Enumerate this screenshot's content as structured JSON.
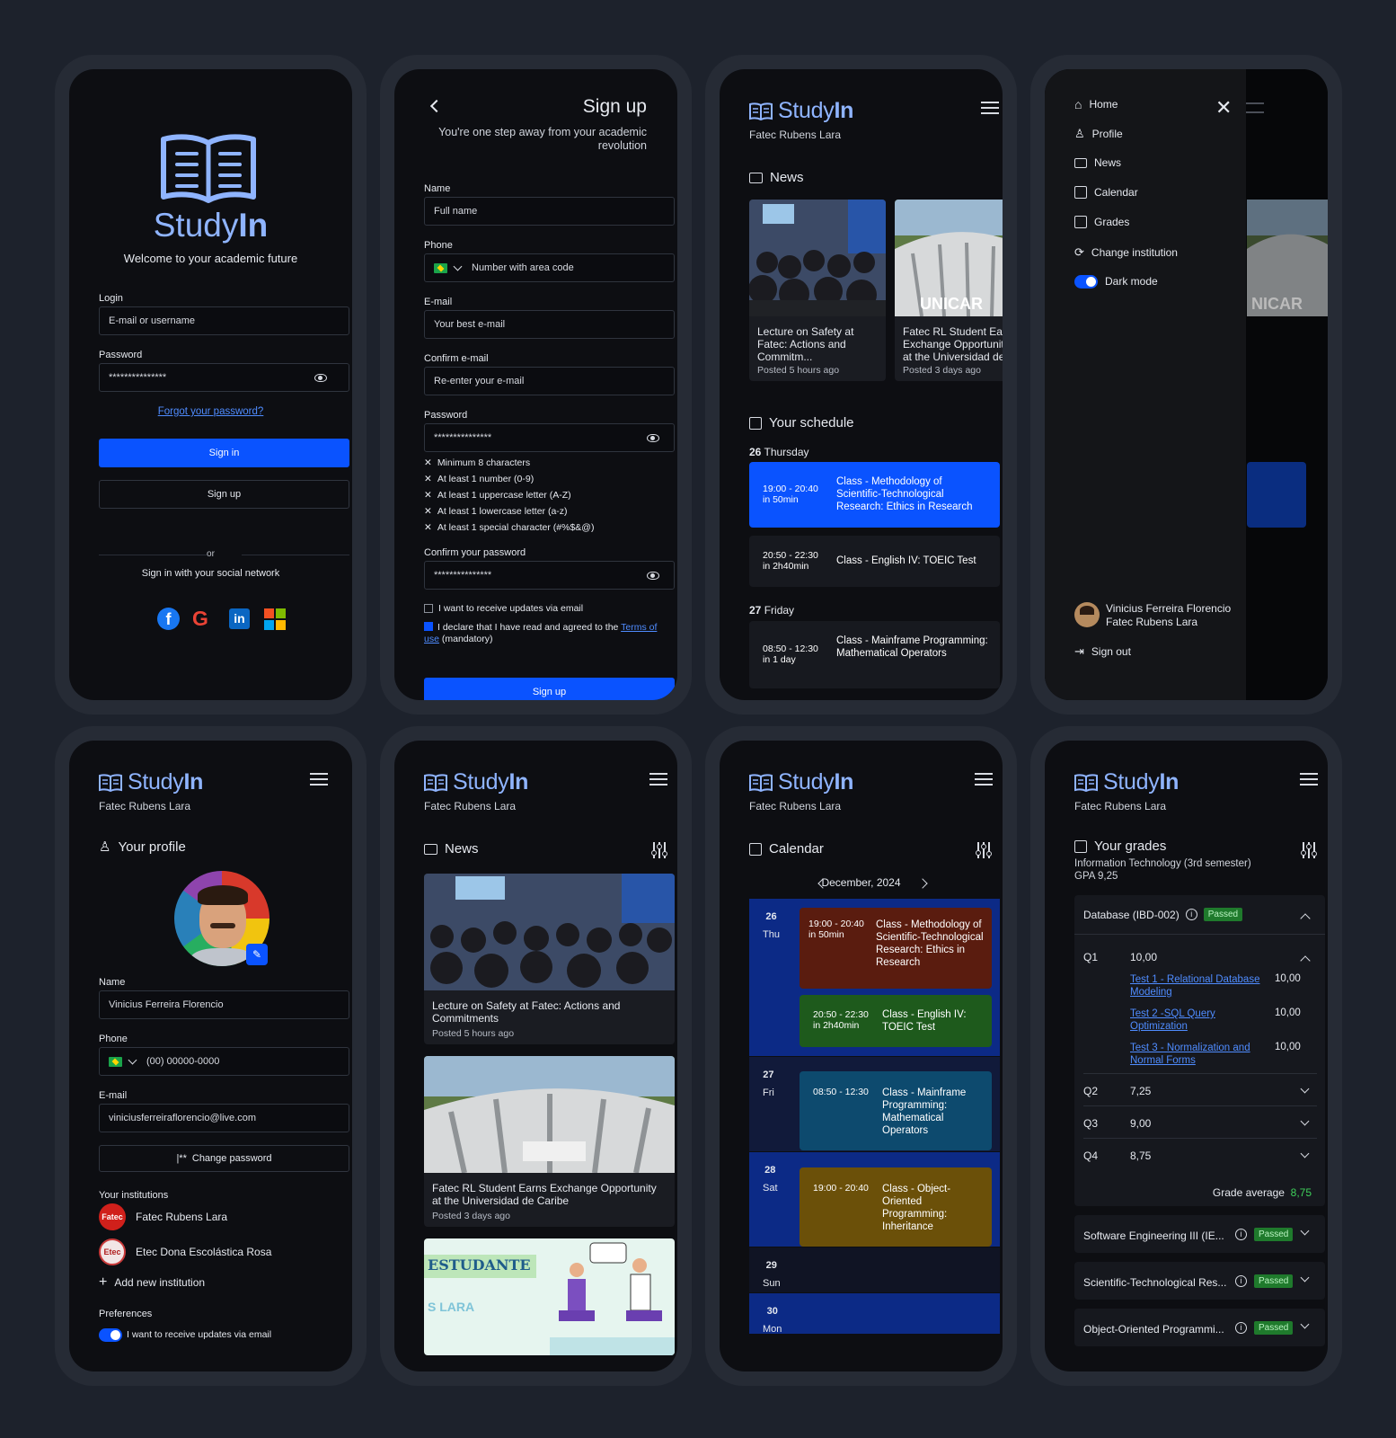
{
  "brand": {
    "name_a": "Study",
    "name_b": "In",
    "institution": "Fatec Rubens Lara"
  },
  "login": {
    "welcome": "Welcome to your academic future",
    "login_label": "Login",
    "login_placeholder": "E-mail or username",
    "password_label": "Password",
    "password_value": "***************",
    "forgot": "Forgot your password?",
    "signin": "Sign in",
    "signup": "Sign up",
    "or": "or",
    "social": "Sign in with your social network"
  },
  "signup": {
    "title": "Sign up",
    "subtitle": "You're one step away from your academic revolution",
    "name_label": "Name",
    "name_ph": "Full name",
    "phone_label": "Phone",
    "phone_ph": "Number with area code",
    "email_label": "E-mail",
    "email_ph": "Your best e-mail",
    "confirm_email_label": "Confirm e-mail",
    "confirm_email_ph": "Re-enter your e-mail",
    "password_label": "Password",
    "password_value": "***************",
    "rules": [
      "Minimum 8 characters",
      "At least 1 number (0-9)",
      "At least 1 uppercase letter (A-Z)",
      "At least 1 lowercase letter (a-z)",
      "At least 1 special character (#%$&@)"
    ],
    "confirm_pw_label": "Confirm your password",
    "confirm_pw_value": "***************",
    "updates": "I want to receive updates via email",
    "declare_a": "I declare that I have read and agreed to the ",
    "terms": "Terms of use",
    "declare_b": " (mandatory)",
    "submit": "Sign up"
  },
  "home": {
    "news_title": "News",
    "news": [
      {
        "title": "Lecture on Safety at Fatec: Actions and Commitm...",
        "meta": "Posted 5 hours ago"
      },
      {
        "title": "Fatec RL Student Earns Exchange Opportunity at the Universidad de...",
        "meta": "Posted 3 days ago"
      }
    ],
    "schedule_title": "Your schedule",
    "days": [
      {
        "num": "26",
        "name": "Thursday"
      },
      {
        "num": "27",
        "name": "Friday"
      }
    ],
    "items": [
      {
        "time": "19:00 - 20:40",
        "rel": "in 50min",
        "title": "Class - Methodology of Scientific-Technological Research: Ethics in Research"
      },
      {
        "time": "20:50 - 22:30",
        "rel": "in 2h40min",
        "title": "Class - English IV: TOEIC Test"
      },
      {
        "time": "08:50 - 12:30",
        "rel": "in 1 day",
        "title": "Class - Mainframe Programming: Mathematical Operators"
      }
    ]
  },
  "menu": {
    "items": [
      "Home",
      "Profile",
      "News",
      "Calendar",
      "Grades",
      "Change institution"
    ],
    "dark": "Dark mode",
    "user": "Vinicius Ferreira Florencio",
    "inst": "Fatec Rubens Lara",
    "signout": "Sign out"
  },
  "profile": {
    "title": "Your profile",
    "name_label": "Name",
    "name": "Vinicius Ferreira Florencio",
    "phone_label": "Phone",
    "phone": "(00) 00000-0000",
    "email_label": "E-mail",
    "email": "viniciusferreiraflorencio@live.com",
    "change_pw": "Change password",
    "inst_title": "Your institutions",
    "insts": [
      "Fatec Rubens Lara",
      "Etec Dona Escolástica Rosa"
    ],
    "inst_logos": [
      "Fatec",
      "Etec"
    ],
    "add": "Add new institution",
    "prefs": "Preferences",
    "updates": "I want to receive updates via email"
  },
  "newsfeed": {
    "title": "News",
    "items": [
      {
        "title": "Lecture on Safety at Fatec: Actions and Commitments",
        "meta": "Posted 5 hours ago"
      },
      {
        "title": "Fatec RL Student Earns Exchange Opportunity at the Universidad de Caribe",
        "meta": "Posted 3 days ago"
      }
    ],
    "banner": "ESTUDANTE",
    "banner2": "S LARA"
  },
  "calendar": {
    "title": "Calendar",
    "month": "December, 2024",
    "days": [
      {
        "n": "26",
        "d": "Thu"
      },
      {
        "n": "27",
        "d": "Fri"
      },
      {
        "n": "28",
        "d": "Sat"
      },
      {
        "n": "29",
        "d": "Sun"
      },
      {
        "n": "30",
        "d": "Mon"
      }
    ],
    "events": [
      {
        "time": "19:00 - 20:40",
        "rel": "in 50min",
        "title": "Class - Methodology of Scientific-Technological Research: Ethics in Research",
        "color": "#5a1c0f"
      },
      {
        "time": "20:50 - 22:30",
        "rel": "in 2h40min",
        "title": "Class - English IV: TOEIC Test",
        "color": "#1e5a1c"
      },
      {
        "time": "08:50 - 12:30",
        "rel": "",
        "title": "Class - Mainframe Programming: Mathematical Operators",
        "color": "#0d4a6e"
      },
      {
        "time": "19:00 - 20:40",
        "rel": "",
        "title": "Class - Object-Oriented Programming: Inheritance",
        "color": "#6b5009"
      }
    ]
  },
  "grades": {
    "title": "Your grades",
    "course": "Information Technology (3rd semester)",
    "gpa": "GPA 9,25",
    "subject": "Database (IBD-002)",
    "passed": "Passed",
    "q": [
      {
        "n": "Q1",
        "v": "10,00"
      },
      {
        "n": "Q2",
        "v": "7,25"
      },
      {
        "n": "Q3",
        "v": "9,00"
      },
      {
        "n": "Q4",
        "v": "8,75"
      }
    ],
    "tests": [
      {
        "t": "Test 1 - Relational Database Modeling",
        "v": "10,00"
      },
      {
        "t": "Test 2 -SQL Query Optimization",
        "v": "10,00"
      },
      {
        "t": "Test 3 - Normalization and Normal Forms",
        "v": "10,00"
      }
    ],
    "avg_label": "Grade average",
    "avg": "8,75",
    "others": [
      "Software Engineering III (IE...",
      "Scientific-Technological Res...",
      "Object-Oriented Programmi..."
    ]
  }
}
